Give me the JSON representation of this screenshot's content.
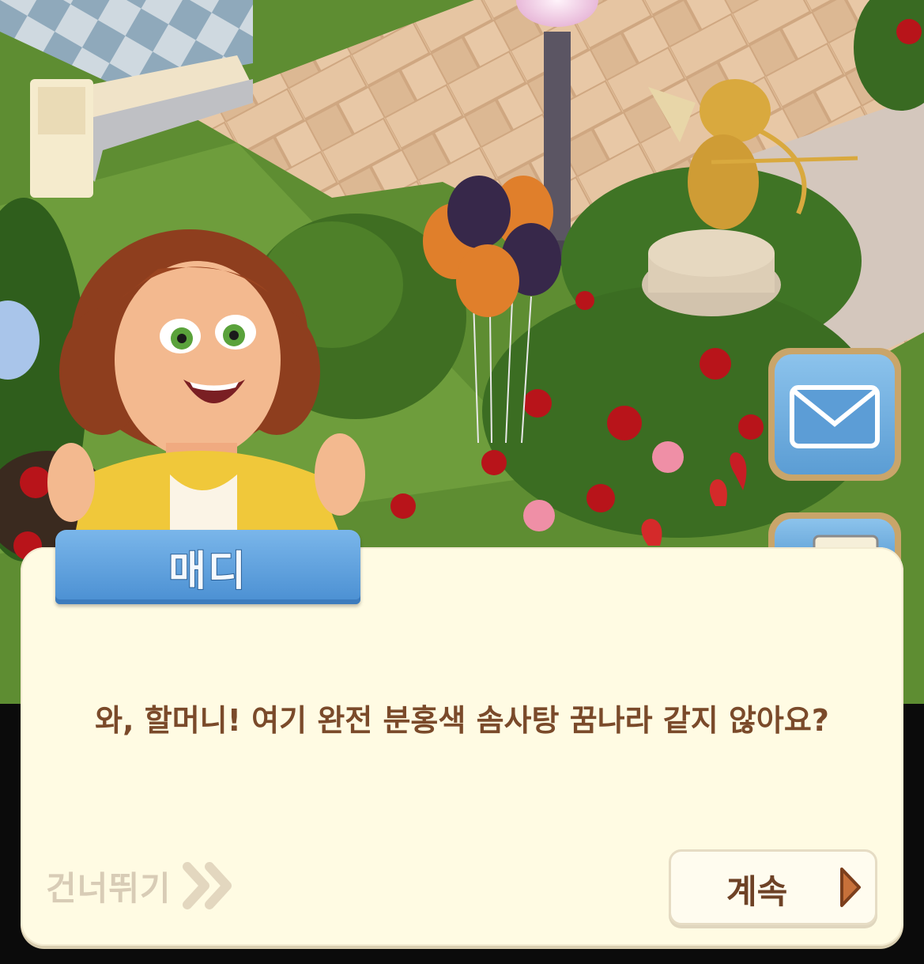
{
  "dialog": {
    "speaker_name": "매디",
    "message": "와, 할머니! 여기 완전 분홍색 솜사탕 꿈나라 같지 않아요?"
  },
  "controls": {
    "skip_label": "건너뛰기",
    "skip_icon": "double-chevron-right-icon",
    "continue_label": "계속",
    "continue_icon": "play-arrow-icon"
  },
  "side_buttons": {
    "mail_icon": "envelope-icon",
    "second_icon": "chat-icon"
  },
  "colors": {
    "dialog_bg": "#fffbe3",
    "name_tab": "#5b9ede",
    "text_brown": "#7a4a2a",
    "skip_gray": "#d8ccb6"
  }
}
